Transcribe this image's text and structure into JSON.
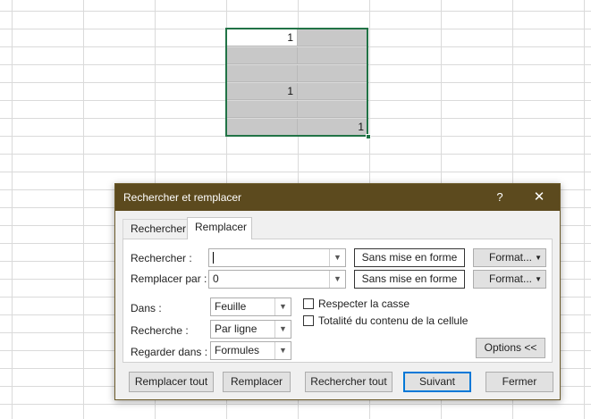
{
  "sheet": {
    "cells": [
      {
        "row": 0,
        "col": 0,
        "value": "1",
        "active": true
      },
      {
        "row": 0,
        "col": 1,
        "value": ""
      },
      {
        "row": 1,
        "col": 0,
        "value": ""
      },
      {
        "row": 1,
        "col": 1,
        "value": ""
      },
      {
        "row": 2,
        "col": 0,
        "value": ""
      },
      {
        "row": 2,
        "col": 1,
        "value": ""
      },
      {
        "row": 3,
        "col": 0,
        "value": "1"
      },
      {
        "row": 3,
        "col": 1,
        "value": ""
      },
      {
        "row": 4,
        "col": 0,
        "value": ""
      },
      {
        "row": 4,
        "col": 1,
        "value": ""
      },
      {
        "row": 5,
        "col": 0,
        "value": ""
      },
      {
        "row": 5,
        "col": 1,
        "value": "1"
      }
    ],
    "selection_color": "#217346"
  },
  "dialog": {
    "title": "Rechercher et remplacer",
    "help": "?",
    "close": "✕",
    "tabs": {
      "find": "Rechercher",
      "replace": "Remplacer"
    },
    "active_tab": "replace",
    "find_label": "Rechercher :",
    "find_value": "",
    "replace_label": "Remplacer par :",
    "replace_value": "0",
    "preview_text": "Sans mise en forme",
    "format_label": "Format...",
    "within_label": "Dans :",
    "within_value": "Feuille",
    "search_label": "Recherche :",
    "search_value": "Par ligne",
    "lookin_label": "Regarder dans :",
    "lookin_value": "Formules",
    "match_case": "Respecter la casse",
    "match_entire": "Totalité du contenu de la cellule",
    "options": "Options <<",
    "buttons": {
      "replace_all": "Remplacer tout",
      "replace": "Remplacer",
      "find_all": "Rechercher tout",
      "next": "Suivant",
      "close": "Fermer"
    },
    "titlebar_color": "#5c4a1e",
    "default_button_border": "#0078d7"
  }
}
